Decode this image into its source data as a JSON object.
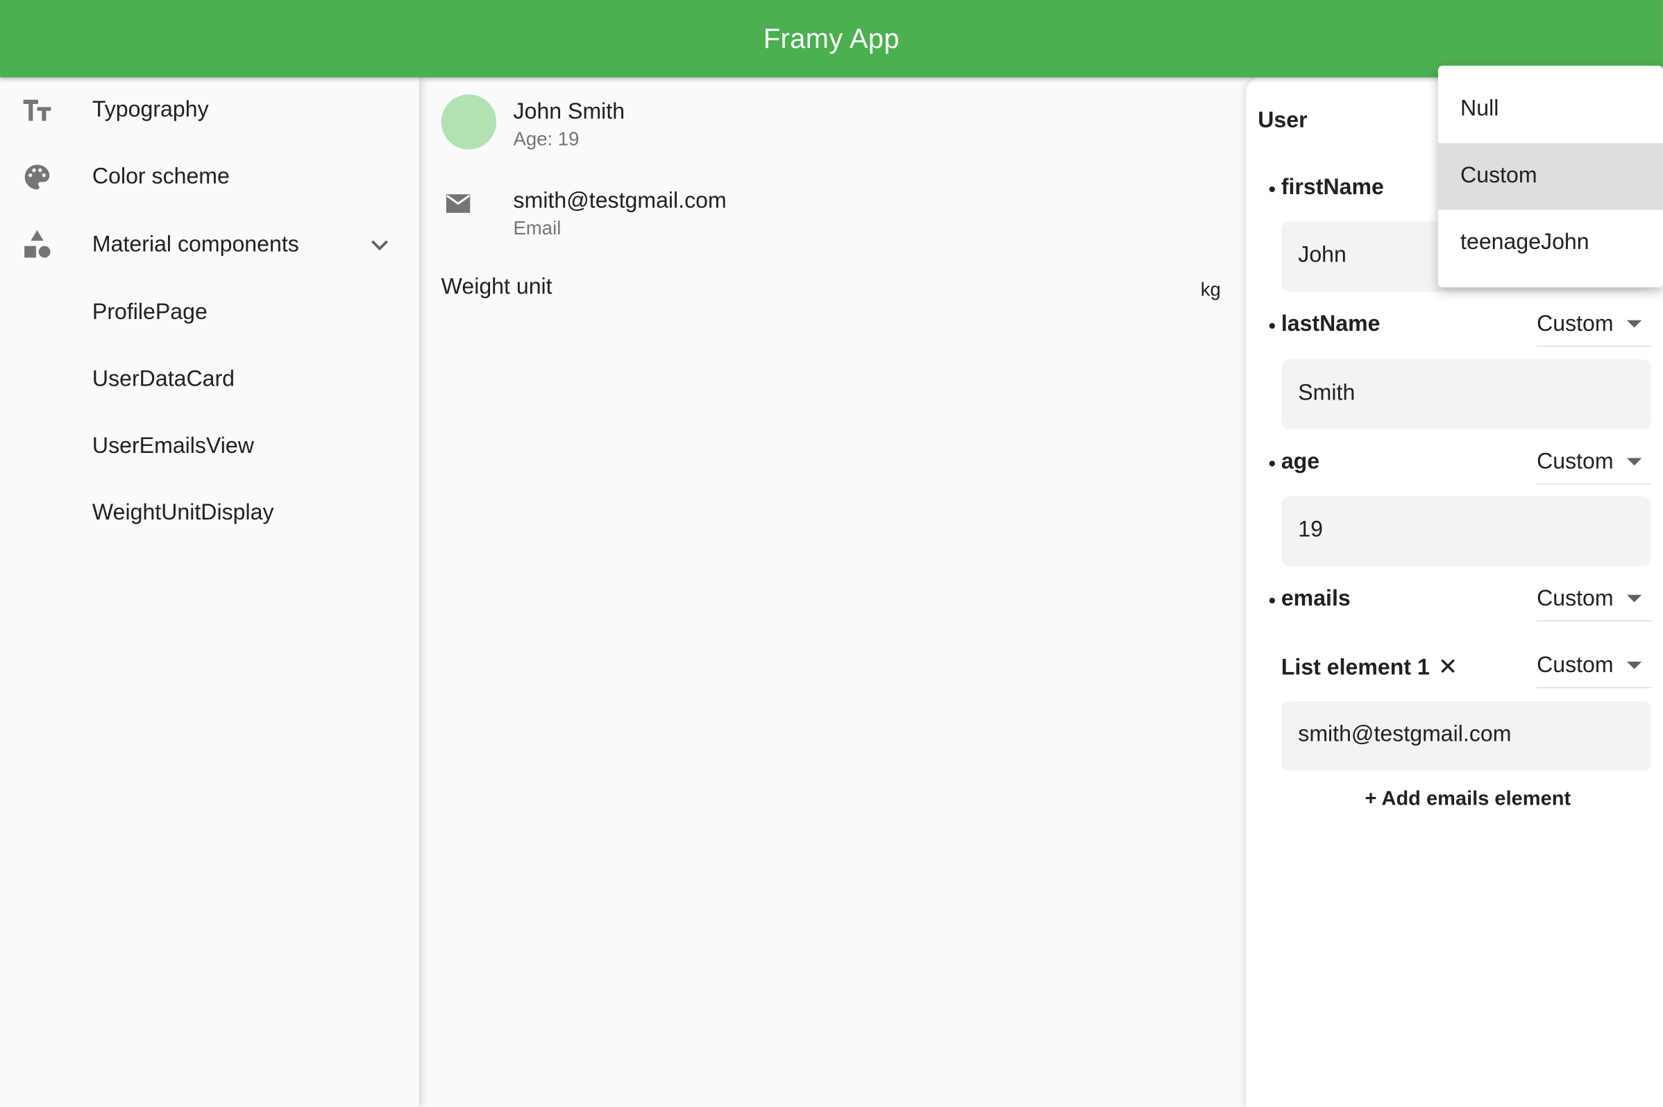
{
  "app": {
    "title": "Framy App",
    "accent_color": "#4caf50"
  },
  "sidebar": {
    "items": [
      {
        "label": "Typography",
        "icon": "text-fields-icon"
      },
      {
        "label": "Color scheme",
        "icon": "palette-icon"
      },
      {
        "label": "Material components",
        "icon": "shapes-icon",
        "expanded": true
      },
      {
        "label": "ProfilePage"
      },
      {
        "label": "UserDataCard"
      },
      {
        "label": "UserEmailsView"
      },
      {
        "label": "WeightUnitDisplay"
      }
    ]
  },
  "content": {
    "user_tile": {
      "name": "John Smith",
      "subtitle": "Age: 19"
    },
    "email_tile": {
      "email": "smith@testgmail.com",
      "subtitle": "Email"
    },
    "weight": {
      "label": "Weight unit",
      "value": "kg"
    }
  },
  "panel": {
    "title": "User",
    "fields": [
      {
        "name": "firstName",
        "mode": "Custom",
        "value": "John"
      },
      {
        "name": "lastName",
        "mode": "Custom",
        "value": "Smith"
      },
      {
        "name": "age",
        "mode": "Custom",
        "value": "19"
      },
      {
        "name": "emails",
        "mode": "Custom"
      }
    ],
    "list_element": {
      "label": "List element 1",
      "remove": "✕",
      "mode": "Custom",
      "value": "smith@testgmail.com"
    },
    "add_button": "+ Add emails element"
  },
  "menu": {
    "options": [
      "Null",
      "Custom",
      "teenageJohn"
    ],
    "selected": "Custom"
  }
}
